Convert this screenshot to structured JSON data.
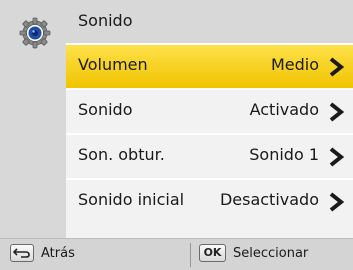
{
  "menu": {
    "title": "Sonido",
    "items": [
      {
        "label": "Volumen",
        "value": "Medio",
        "selected": true
      },
      {
        "label": "Sonido",
        "value": "Activado",
        "selected": false
      },
      {
        "label": "Son. obtur.",
        "value": "Sonido 1",
        "selected": false
      },
      {
        "label": "Sonido inicial",
        "value": "Desactivado",
        "selected": false
      }
    ]
  },
  "footer": {
    "back_label": "Atrás",
    "ok_key": "OK",
    "select_label": "Seleccionar"
  },
  "icons": {
    "category": "settings-gear-icon",
    "row_arrow": "chevron-right-icon",
    "back_key": "back-arrow-icon"
  },
  "colors": {
    "highlight": "#f5d000",
    "panel": "#d8d8d8",
    "row": "#f2f2f2"
  }
}
